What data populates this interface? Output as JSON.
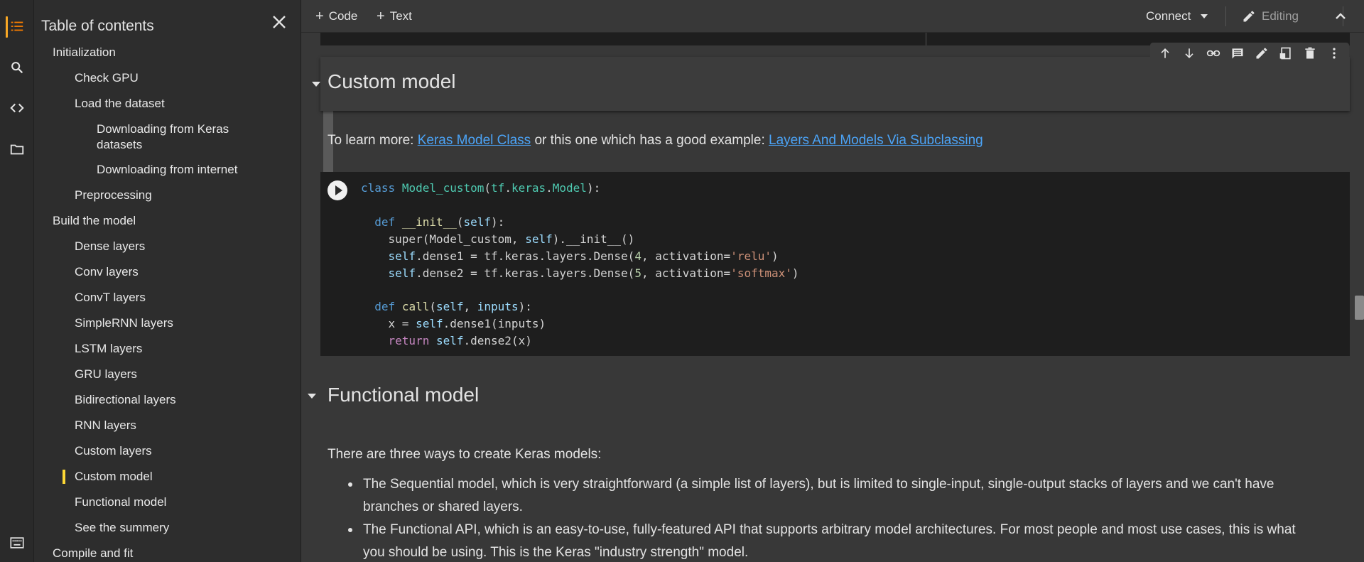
{
  "rail": {
    "items": [
      "table-of-contents-icon",
      "search-icon",
      "code-snippets-icon",
      "files-icon",
      "terminal-icon"
    ]
  },
  "toc": {
    "title": "Table of contents",
    "items": [
      {
        "label": "Initialization",
        "level": 1
      },
      {
        "label": "Check GPU",
        "level": 2
      },
      {
        "label": "Load the dataset",
        "level": 2
      },
      {
        "label": "Downloading from Keras datasets",
        "level": 3
      },
      {
        "label": "Downloading from internet",
        "level": 3
      },
      {
        "label": "Preprocessing",
        "level": 2
      },
      {
        "label": "Build the model",
        "level": 1
      },
      {
        "label": "Dense layers",
        "level": 2
      },
      {
        "label": "Conv layers",
        "level": 2
      },
      {
        "label": "ConvT layers",
        "level": 2
      },
      {
        "label": "SimpleRNN layers",
        "level": 2
      },
      {
        "label": "LSTM layers",
        "level": 2
      },
      {
        "label": "GRU layers",
        "level": 2
      },
      {
        "label": "Bidirectional layers",
        "level": 2
      },
      {
        "label": "RNN layers",
        "level": 2
      },
      {
        "label": "Custom layers",
        "level": 2
      },
      {
        "label": "Custom model",
        "level": 2,
        "active": true
      },
      {
        "label": "Functional model",
        "level": 2
      },
      {
        "label": "See the summery",
        "level": 2
      },
      {
        "label": "Compile and fit",
        "level": 1
      }
    ]
  },
  "toolbar": {
    "code_label": "Code",
    "text_label": "Text",
    "connect_label": "Connect",
    "editing_label": "Editing"
  },
  "sections": {
    "custom_model": {
      "heading": "Custom model",
      "learn_prefix": "To learn more: ",
      "link1": "Keras Model Class",
      "learn_mid": " or this one which has a good example: ",
      "link2": "Layers And Models Via Subclassing"
    },
    "functional_model": {
      "heading": "Functional model",
      "intro": "There are three ways to create Keras models:",
      "bullets": [
        "The Sequential model, which is very straightforward (a simple list of layers), but is limited to single-input, single-output stacks of layers and we can't have branches or shared layers.",
        "The Functional API, which is an easy-to-use, fully-featured API that supports arbitrary model architectures. For most people and most use cases, this is what you should be using. This is the Keras \"industry strength\" model."
      ]
    }
  },
  "code_lines": [
    "class Model_custom(tf.keras.Model):",
    "",
    "  def __init__(self):",
    "    super(Model_custom, self).__init__()",
    "    self.dense1 = tf.keras.layers.Dense(4, activation='relu')",
    "    self.dense2 = tf.keras.layers.Dense(5, activation='softmax')",
    "",
    "  def call(self, inputs):",
    "    x = self.dense1(inputs)",
    "    return self.dense2(x)"
  ],
  "cell_toolbar_icons": [
    "move-up-icon",
    "move-down-icon",
    "link-icon",
    "comment-icon",
    "edit-icon",
    "mirror-cell-icon",
    "delete-icon",
    "more-icon"
  ]
}
